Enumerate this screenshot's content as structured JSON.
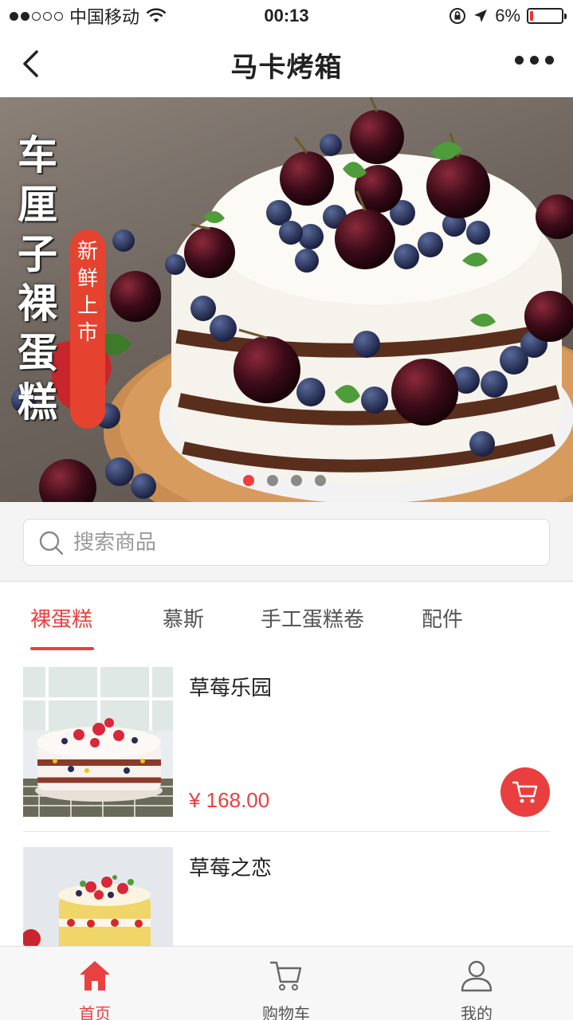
{
  "status_bar": {
    "carrier": "中国移动",
    "time": "00:13",
    "battery": "6%",
    "battery_level": 0.06
  },
  "nav": {
    "title": "马卡烤箱"
  },
  "banner": {
    "title": "车厘子裸蛋糕",
    "tag": "新鲜上市",
    "slide_count": 4,
    "active_slide": 1
  },
  "search": {
    "placeholder": "搜索商品"
  },
  "tabs": [
    {
      "label": "裸蛋糕",
      "active": true
    },
    {
      "label": "慕斯",
      "active": false
    },
    {
      "label": "手工蛋糕卷",
      "active": false
    },
    {
      "label": "配件",
      "active": false
    }
  ],
  "products": [
    {
      "name": "草莓乐园",
      "price": "¥ 168.00"
    },
    {
      "name": "草莓之恋",
      "price": ""
    }
  ],
  "tab_bar": [
    {
      "label": "首页",
      "icon": "home-icon",
      "active": true
    },
    {
      "label": "购物车",
      "icon": "cart-icon",
      "active": false
    },
    {
      "label": "我的",
      "icon": "user-icon",
      "active": false
    }
  ],
  "colors": {
    "accent": "#e94040",
    "banner_tag": "#e5432f"
  }
}
